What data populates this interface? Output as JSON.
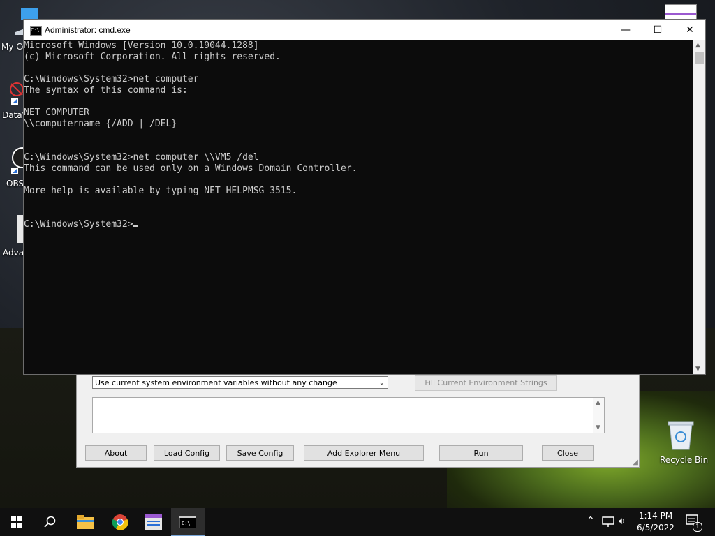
{
  "desktop": {
    "icons": [
      {
        "label": "My Co",
        "icon": "computer-icon"
      },
      {
        "label": "DataV",
        "icon": "datavis-icon"
      },
      {
        "label": "OBS",
        "icon": "obs-icon"
      },
      {
        "label": "Advan",
        "icon": "app-icon"
      },
      {
        "label": "Recycle Bin",
        "icon": "recycle-bin-icon"
      }
    ]
  },
  "cmd_window": {
    "title": "Administrator: cmd.exe",
    "lines": [
      "Microsoft Windows [Version 10.0.19044.1288]",
      "(c) Microsoft Corporation. All rights reserved.",
      "",
      "C:\\Windows\\System32>net computer",
      "The syntax of this command is:",
      "",
      "NET COMPUTER",
      "\\\\computername {/ADD | /DEL}",
      "",
      "",
      "C:\\Windows\\System32>net computer \\\\VM5 /del",
      "This command can be used only on a Windows Domain Controller.",
      "",
      "More help is available by typing NET HELPMSG 3515.",
      "",
      "",
      "C:\\Windows\\System32>"
    ],
    "controls": {
      "minimize": "—",
      "maximize": "☐",
      "close": "✕"
    }
  },
  "background_app": {
    "env_select_value": "Use current system environment variables without any change",
    "fill_button": "Fill Current Environment Strings",
    "buttons": {
      "about": "About",
      "load_config": "Load Config",
      "save_config": "Save Config",
      "add_explorer_menu": "Add Explorer Menu",
      "run": "Run",
      "close": "Close"
    }
  },
  "taskbar": {
    "apps": [
      "start-icon",
      "search-icon",
      "file-explorer-icon",
      "chrome-icon",
      "app-window-icon",
      "cmd-icon"
    ],
    "time": "1:14 PM",
    "date": "6/5/2022",
    "notification_count": "1"
  }
}
